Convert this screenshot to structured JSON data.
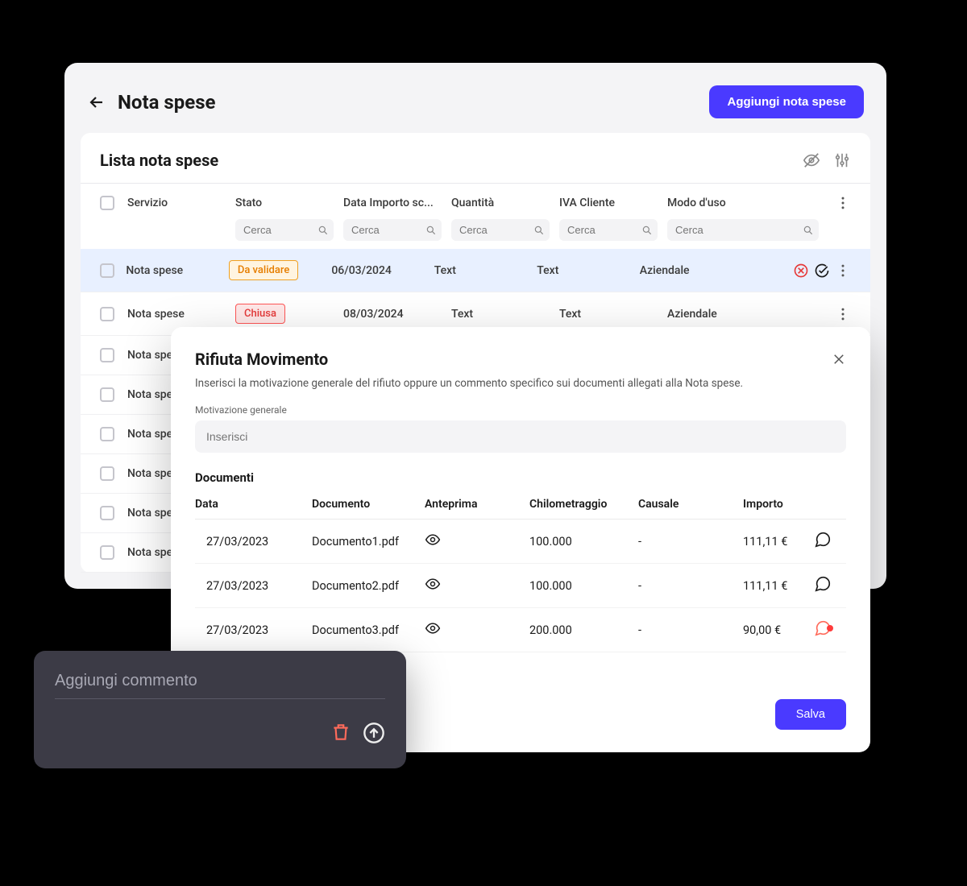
{
  "header": {
    "title": "Nota spese",
    "add_button": "Aggiungi nota spese"
  },
  "list": {
    "title": "Lista nota spese",
    "columns": {
      "servizio": "Servizio",
      "stato": "Stato",
      "data": "Data Importo sc...",
      "quantita": "Quantità",
      "iva": "IVA Cliente",
      "modo": "Modo d'uso"
    },
    "search_placeholder": "Cerca",
    "rows": [
      {
        "servizio": "Nota spese",
        "stato": "Da validare",
        "stato_type": "orange",
        "data": "06/03/2024",
        "quantita": "Text",
        "iva": "Text",
        "modo": "Aziendale",
        "highlight": true,
        "actions": true
      },
      {
        "servizio": "Nota spese",
        "stato": "Chiusa",
        "stato_type": "red",
        "data": "08/03/2024",
        "quantita": "Text",
        "iva": "Text",
        "modo": "Aziendale"
      },
      {
        "servizio": "Nota spese"
      },
      {
        "servizio": "Nota spese"
      },
      {
        "servizio": "Nota spese"
      },
      {
        "servizio": "Nota spese"
      },
      {
        "servizio": "Nota spese"
      },
      {
        "servizio": "Nota spese"
      }
    ]
  },
  "modal": {
    "title": "Rifiuta Movimento",
    "description": "Inserisci la motivazione generale del rifiuto oppure un commento specifico sui documenti allegati alla Nota spese.",
    "motivation_label": "Motivazione generale",
    "motivation_placeholder": "Inserisci",
    "docs_title": "Documenti",
    "columns": {
      "data": "Data",
      "documento": "Documento",
      "anteprima": "Anteprima",
      "km": "Chilometraggio",
      "causale": "Causale",
      "importo": "Importo"
    },
    "docs": [
      {
        "data": "27/03/2023",
        "documento": "Documento1.pdf",
        "km": "100.000",
        "causale": "-",
        "importo": "111,11 €",
        "has_dot": false
      },
      {
        "data": "27/03/2023",
        "documento": "Documento2.pdf",
        "km": "100.000",
        "causale": "-",
        "importo": "111,11 €",
        "has_dot": false
      },
      {
        "data": "27/03/2023",
        "documento": "Documento3.pdf",
        "km": "200.000",
        "causale": "-",
        "importo": "90,00 €",
        "has_dot": true
      }
    ],
    "save_label": "Salva"
  },
  "comment": {
    "placeholder": "Aggiungi commento"
  }
}
